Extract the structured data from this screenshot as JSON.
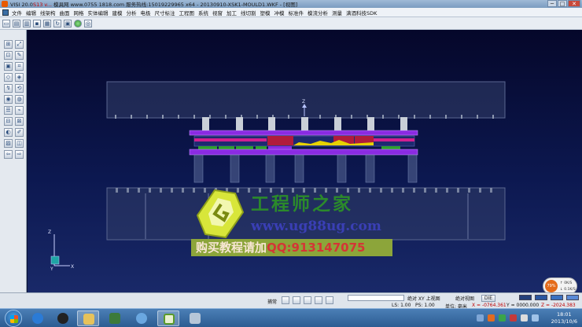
{
  "window": {
    "title_prefix": "VISI 20.0",
    "title_red": "S13 v... ",
    "title_rest": "模具网 www.0755 1818.com 服务热线:15019229965 x64 - 20130910-XSK1-MOULD1.WKF - [视图]",
    "minimize": "─",
    "maximize": "□",
    "close": "✕"
  },
  "menu": [
    "文件",
    "编辑",
    "线架构",
    "曲面",
    "网格",
    "实体编辑",
    "建模",
    "分析",
    "电极",
    "尺寸标注",
    "工程图",
    "系统",
    "视窗",
    "加工",
    "线切割",
    "塑模",
    "冲模",
    "标准件",
    "模流分析",
    "测量",
    "满酒科技SDK"
  ],
  "toolbar": [
    {
      "name": "new-icon",
      "glyph": "▭"
    },
    {
      "name": "open-icon",
      "glyph": "▤"
    },
    {
      "name": "folder-icon",
      "glyph": "▥"
    },
    {
      "name": "save-icon",
      "glyph": "▪"
    },
    {
      "name": "print-icon",
      "glyph": "▦"
    },
    {
      "name": "refresh-icon",
      "glyph": "↻"
    },
    {
      "name": "export-icon",
      "glyph": "▣"
    },
    {
      "name": "green-ball-icon",
      "glyph": ""
    },
    {
      "name": "settings-icon",
      "glyph": "◎"
    }
  ],
  "sidebar_tools": [
    "⊞",
    "⤢",
    "⊡",
    "✎",
    "▣",
    "⌗",
    "◇",
    "◈",
    "↯",
    "⟲",
    "◉",
    "◍",
    "☰",
    "⌁",
    "⊟",
    "⊠",
    "◐",
    "✐",
    "▨",
    "◫",
    "⇦",
    "⇨"
  ],
  "viewport": {
    "axis_top_label": "Z",
    "axis_z": "Z",
    "axis_y": "Y",
    "axis_x": "X"
  },
  "watermark": {
    "title": "工程师之家",
    "url": "www.ug88ug.com",
    "contact_prefix": "购买教程请加",
    "contact_qq": "QQ:913147075"
  },
  "ram_widget": {
    "percent": "79%",
    "up": "0K/S",
    "down": "0.1K/S"
  },
  "status": {
    "catch": "捕常",
    "rel_xy": "绝对 XY 上视图",
    "abs_view": "绝对视图",
    "die": "DIE",
    "ls": "LS: 1.00",
    "ps": "PS: 1.00",
    "unit": "单位: 毫米",
    "x": "X = -0764.361",
    "y": "Y = 0000.000",
    "z": "Z = -2024.383"
  },
  "clock": {
    "time": "18:01",
    "date": "2013/10/6"
  },
  "colors": {
    "purple_plate": "#8a2be2",
    "magenta": "#d02090",
    "green": "#2ea02e",
    "red": "#b01c3c",
    "yellow": "#e6d200",
    "pillar": "#c9cfd8",
    "blue": "#2b3fc4"
  }
}
